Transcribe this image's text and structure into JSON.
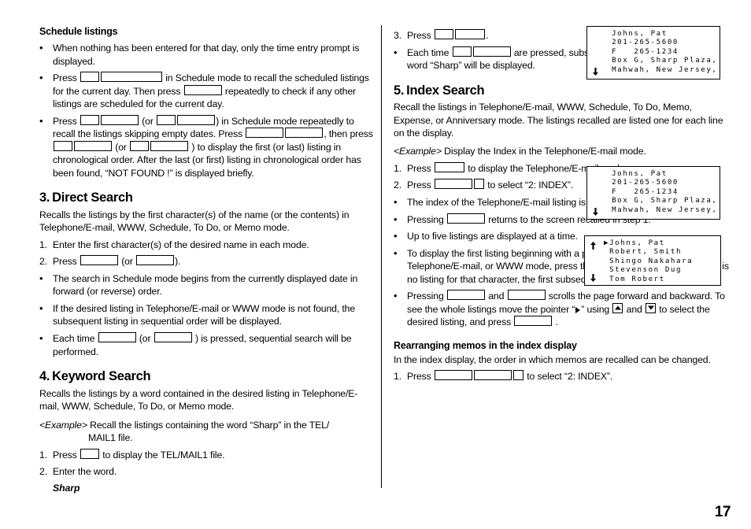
{
  "page": {
    "number": "17"
  },
  "left_column": {
    "schedule_listings": {
      "heading": "Schedule listings",
      "bullets": [
        {
          "parts": [
            {
              "t": "text",
              "v": "When nothing has been entered for that day, only the time entry prompt is displayed."
            }
          ]
        },
        {
          "parts": [
            {
              "t": "text",
              "v": "Press "
            },
            {
              "t": "key",
              "w": "w1"
            },
            {
              "t": "key",
              "w": "w5"
            },
            {
              "t": "text",
              "v": " in Schedule mode to recall the scheduled listings for the current day. Then press "
            },
            {
              "t": "key",
              "w": "w3"
            },
            {
              "t": "text",
              "v": " repeatedly to check if any other listings are scheduled for the current day."
            }
          ]
        },
        {
          "parts": [
            {
              "t": "text",
              "v": "Press "
            },
            {
              "t": "key",
              "w": "w1"
            },
            {
              "t": "key",
              "w": "w3"
            },
            {
              "t": "text",
              "v": " (or "
            },
            {
              "t": "key",
              "w": "w1"
            },
            {
              "t": "key",
              "w": "w3"
            },
            {
              "t": "text",
              "v": ") in Schedule mode repeatedly to recall the listings skipping empty dates. Press "
            },
            {
              "t": "key",
              "w": "w3"
            },
            {
              "t": "key",
              "w": "w3"
            },
            {
              "t": "text",
              "v": ", then press "
            },
            {
              "t": "key",
              "w": "w1"
            },
            {
              "t": "key",
              "w": "w3"
            },
            {
              "t": "text",
              "v": " (or "
            },
            {
              "t": "key",
              "w": "w1"
            },
            {
              "t": "key",
              "w": "w3"
            },
            {
              "t": "text",
              "v": " ) to display the first (or last) listing in chronological order. After the last (or first) listing in chronological order has been found, “NOT FOUND !” is displayed briefly."
            }
          ]
        }
      ]
    },
    "direct_search": {
      "number": "3.",
      "heading": "Direct Search",
      "intro": "Recalls the listings by the first character(s) of the name (or the contents) in Telephone/E-mail, WWW, Schedule, To Do, or Memo mode.",
      "steps": [
        {
          "mark": "1.",
          "parts": [
            {
              "t": "text",
              "v": "Enter the first character(s) of the desired name in each mode."
            }
          ]
        },
        {
          "mark": "2.",
          "parts": [
            {
              "t": "text",
              "v": "Press "
            },
            {
              "t": "key",
              "w": "w3"
            },
            {
              "t": "text",
              "v": " (or "
            },
            {
              "t": "key",
              "w": "w3"
            },
            {
              "t": "text",
              "v": ")."
            }
          ]
        },
        {
          "mark": "•",
          "parts": [
            {
              "t": "text",
              "v": "The search in Schedule mode begins from the currently displayed date in forward (or reverse) order."
            }
          ]
        },
        {
          "mark": "•",
          "parts": [
            {
              "t": "text",
              "v": "If the desired listing in Telephone/E-mail or WWW mode is not found, the subsequent listing in sequential order will be displayed."
            }
          ]
        },
        {
          "mark": "•",
          "parts": [
            {
              "t": "text",
              "v": "Each time "
            },
            {
              "t": "key",
              "w": "w3"
            },
            {
              "t": "text",
              "v": " (or "
            },
            {
              "t": "key",
              "w": "w3"
            },
            {
              "t": "text",
              "v": " ) is pressed, sequential search will be performed."
            }
          ]
        }
      ]
    },
    "keyword_search": {
      "number": "4.",
      "heading": "Keyword Search",
      "intro": "Recalls the listings by a word contained in the desired listing in Telephone/E-mail, WWW, Schedule, To Do, or Memo mode.",
      "example_label": "<Example>",
      "example_line1": " Recall the listings containing the word “Sharp” in the TEL/",
      "example_line2": "MAIL1 file.",
      "steps": [
        {
          "mark": "1.",
          "parts": [
            {
              "t": "text",
              "v": "Press "
            },
            {
              "t": "key",
              "w": "w1"
            },
            {
              "t": "text",
              "v": " to display the TEL/MAIL1 file."
            }
          ]
        },
        {
          "mark": "2.",
          "parts": [
            {
              "t": "text",
              "v": "Enter the word."
            }
          ]
        }
      ],
      "entered_word": "Sharp"
    }
  },
  "right_column": {
    "keyword_search_cont": {
      "steps": [
        {
          "mark": "3.",
          "parts": [
            {
              "t": "text",
              "v": "Press "
            },
            {
              "t": "key",
              "w": "w1"
            },
            {
              "t": "key",
              "w": "w2"
            },
            {
              "t": "text",
              "v": "."
            }
          ]
        },
        {
          "mark": "•",
          "parts": [
            {
              "t": "text",
              "v": "Each time "
            },
            {
              "t": "key",
              "w": "w1"
            },
            {
              "t": "key",
              "w": "w3"
            },
            {
              "t": "text",
              "v": " are pressed, subsequent listings containing the word “Sharp” will be displayed."
            }
          ]
        }
      ]
    },
    "index_search": {
      "number": "5.",
      "heading": "Index Search",
      "intro": "Recall the listings in Telephone/E-mail, WWW, Schedule, To Do, Memo, Expense, or Anniversary mode. The listings recalled are listed one for each line on the display.",
      "example_label": "<Example>",
      "example_text": " Display the Index in the Telephone/E-mail mode.",
      "steps": [
        {
          "mark": "1.",
          "parts": [
            {
              "t": "text",
              "v": "Press "
            },
            {
              "t": "key",
              "w": "w2"
            },
            {
              "t": "text",
              "v": " to display the Telephone/E-mail mode screen."
            }
          ]
        },
        {
          "mark": "2.",
          "parts": [
            {
              "t": "text",
              "v": "Press "
            },
            {
              "t": "key",
              "w": "w3"
            },
            {
              "t": "key",
              "w": "sq"
            },
            {
              "t": "text",
              "v": " to select “2: INDEX”."
            }
          ]
        },
        {
          "mark": "•",
          "parts": [
            {
              "t": "text",
              "v": "The index of the Telephone/E-mail listing is displayed."
            }
          ]
        },
        {
          "mark": "•",
          "parts": [
            {
              "t": "text",
              "v": "Pressing "
            },
            {
              "t": "key",
              "w": "w3"
            },
            {
              "t": "text",
              "v": " returns to the screen recalled in step 1."
            }
          ]
        },
        {
          "mark": "•",
          "parts": [
            {
              "t": "text",
              "v": "Up to five listings are displayed at a time."
            }
          ]
        },
        {
          "mark": "•",
          "parts": [
            {
              "t": "text",
              "v": "To display the first listing beginning with a particular character in the Telephone/E-mail, or WWW mode, press the desired character key. If there is no listing for that character, the first subsequent listing will be displayed."
            }
          ]
        },
        {
          "mark": "•",
          "parts": [
            {
              "t": "text",
              "v": "Pressing "
            },
            {
              "t": "key",
              "w": "w3"
            },
            {
              "t": "text",
              "v": " and "
            },
            {
              "t": "key",
              "w": "w3"
            },
            {
              "t": "text",
              "v": " scrolls the page forward and backward. To see the whole listings move the pointer “"
            },
            {
              "t": "ptr"
            },
            {
              "t": "text",
              "v": "” using "
            },
            {
              "t": "arrowup"
            },
            {
              "t": "text",
              "v": " and "
            },
            {
              "t": "arrowdown"
            },
            {
              "t": "text",
              "v": " to select the desired listing, and press "
            },
            {
              "t": "key",
              "w": "w3"
            },
            {
              "t": "text",
              "v": " ."
            }
          ]
        }
      ]
    },
    "rearranging": {
      "heading": "Rearranging memos in the index display",
      "intro": "In the index display, the order in which memos are recalled can be changed.",
      "steps": [
        {
          "mark": "1.",
          "parts": [
            {
              "t": "text",
              "v": "Press "
            },
            {
              "t": "key",
              "w": "w3"
            },
            {
              "t": "key",
              "w": "w3"
            },
            {
              "t": "key",
              "w": "sq"
            },
            {
              "t": "text",
              "v": " to select “2: INDEX”."
            }
          ]
        }
      ]
    }
  },
  "displays": {
    "lcd_contact_top": {
      "name": "contact-detail-display",
      "lines": [
        "Johns, Pat",
        "201-265-5600",
        "F   265-1234",
        "Box G, Sharp Plaza,",
        "Mahwah, New Jersey,"
      ],
      "scroll_down": true,
      "scroll_up": false
    },
    "lcd_contact_mid": {
      "name": "telephone-mode-display",
      "lines": [
        "Johns, Pat",
        "201-265-5600",
        "F   265-1234",
        "Box G, Sharp Plaza,",
        "Mahwah, New Jersey,"
      ],
      "scroll_down": true,
      "scroll_up": false
    },
    "lcd_index": {
      "name": "index-list-display",
      "lines": [
        "Johns, Pat",
        "Robert, Smith",
        "Shingo Nakahara",
        "Stevenson Dug",
        "Tom Robert"
      ],
      "pointer_on_line": 0,
      "scroll_down": true,
      "scroll_up": true
    }
  }
}
